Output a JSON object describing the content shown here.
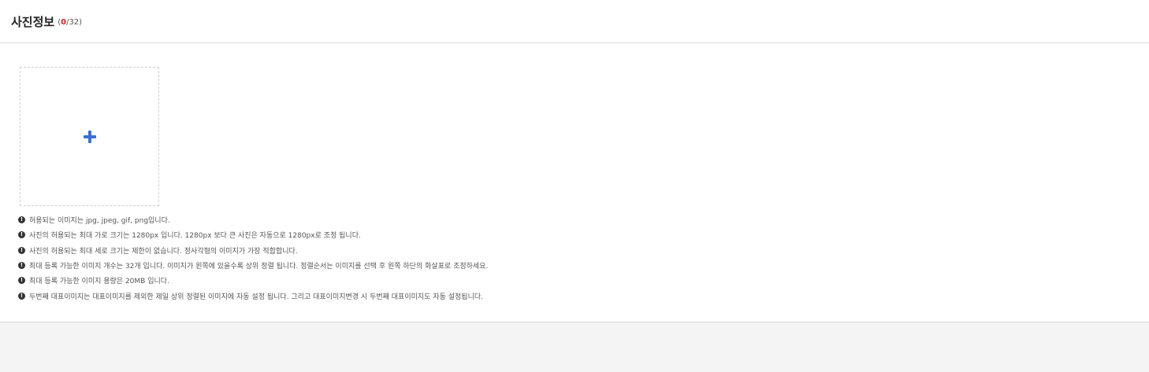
{
  "header": {
    "title": "사진정보",
    "count_open": "(",
    "count_current": "0",
    "count_total": "/32)"
  },
  "upload": {
    "icon": "plus-icon",
    "accent_color": "#3b6fd8"
  },
  "notes_icon": "exclamation-circle-icon",
  "notes_icon_glyph": "!",
  "notes": [
    "허용되는 이미지는 jpg, jpeg, gif, png입니다.",
    "사진의 허용되는 최대 가로 크기는 1280px 입니다. 1280px 보다 큰 사진은 자동으로 1280px로 조정 됩니다.",
    "사진의 허용되는 최대 세로 크기는 제한이 없습니다. 정사각형의 이미지가 가장 적합합니다.",
    "최대 등록 가능한 이미지 개수는 32개 입니다. 이미지가 왼쪽에 있을수록 상위 정렬 됩니다. 정렬순서는 이미지를 선택 후 왼쪽 하단의 화살표로 조정하세요.",
    "최대 등록 가능한 이미지 용량은 20MB 입니다.",
    "두번째 대표이미지는 대표이미지를 제외한 제일 상위 정렬된 이미지에 자동 설정 됩니다. 그리고 대표이미지변경 시 두번째 대표이미지도 자동 설정됩니다."
  ]
}
